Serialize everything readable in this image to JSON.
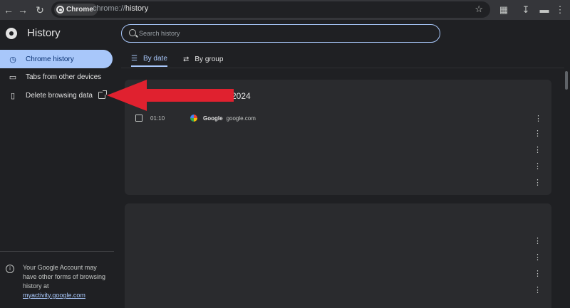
{
  "toolbar": {
    "back_icon": "back-arrow-icon",
    "forward_icon": "forward-arrow-icon",
    "reload_icon": "reload-icon",
    "chip_label": "Chrome",
    "url_prefix": "chrome://",
    "url_path": "history",
    "star_icon": "star-icon",
    "extensions_icon": "puzzle-icon",
    "download_icon": "download-icon",
    "menu_icon": "more-vert-icon"
  },
  "sidebar": {
    "title": "History",
    "items": [
      {
        "label": "Chrome history",
        "icon": "history-icon",
        "active": true
      },
      {
        "label": "Tabs from other devices",
        "icon": "devices-icon",
        "active": false
      },
      {
        "label": "Delete browsing data",
        "icon": "trash-icon",
        "active": false
      }
    ],
    "footer": {
      "text": "Your Google Account may have other forms of browsing history at",
      "link": "myactivity.google.com"
    }
  },
  "search": {
    "placeholder": "Search history"
  },
  "tabs": [
    {
      "label": "By date",
      "active": true
    },
    {
      "label": "By group",
      "active": false
    }
  ],
  "results": {
    "card1": {
      "date_header": "2024",
      "rows": [
        {
          "time": "01:10",
          "title": "Google",
          "domain": "google.com"
        }
      ],
      "kebab_count": 5
    },
    "card2": {
      "kebab_count": 4
    }
  },
  "colors": {
    "accent": "#a8c7fa",
    "background": "#1f2023",
    "card": "#2a2b2e",
    "annotation_arrow": "#e0212f"
  }
}
